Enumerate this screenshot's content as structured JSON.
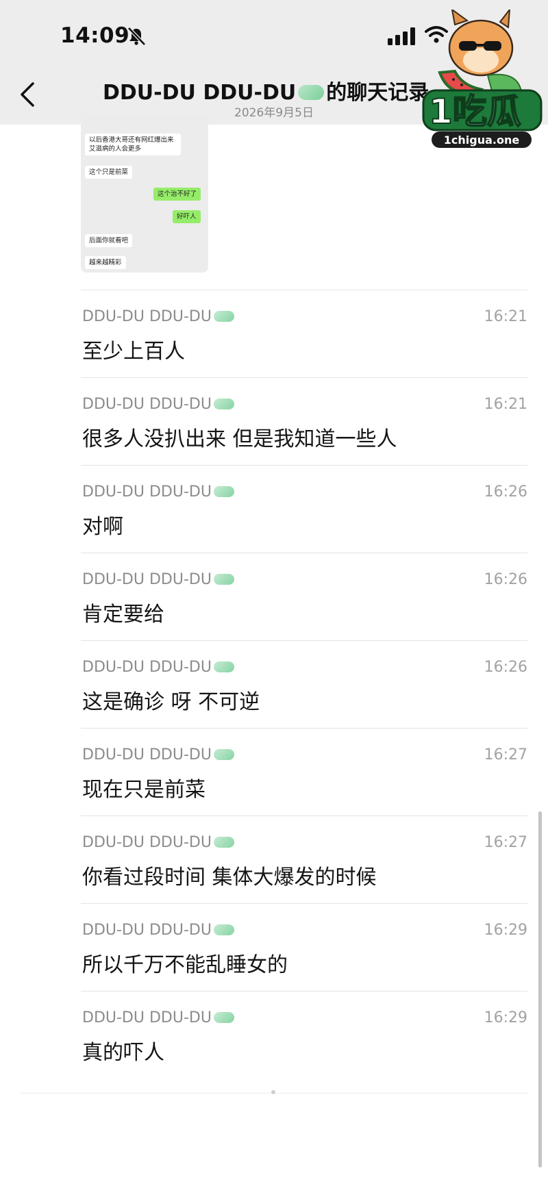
{
  "status_bar": {
    "time": "14:09",
    "icons": [
      "bell-off-icon",
      "signal-icon",
      "wifi-icon"
    ]
  },
  "nav": {
    "back_icon": "chevron-left-icon",
    "title_prefix": "DDU-DU DDU-DU",
    "title_suffix": "的聊天记录",
    "subtitle": "2026年9月5日"
  },
  "shared_image": {
    "messages": [
      {
        "side": "left",
        "text": "以后香港大哥还有网红爆出来艾滋病的人会更多"
      },
      {
        "side": "left",
        "text": "这个只是前菜"
      },
      {
        "side": "right",
        "text": "这个治不好了"
      },
      {
        "side": "right",
        "text": "好吓人"
      },
      {
        "side": "left",
        "text": "后面你就看吧"
      },
      {
        "side": "left",
        "text": "越来越精彩"
      }
    ]
  },
  "messages": [
    {
      "sender": "DDU-DU DDU-DU",
      "time": "16:21",
      "text": "至少上百人"
    },
    {
      "sender": "DDU-DU DDU-DU",
      "time": "16:21",
      "text": "很多人没扒出来 但是我知道一些人"
    },
    {
      "sender": "DDU-DU DDU-DU",
      "time": "16:26",
      "text": "对啊"
    },
    {
      "sender": "DDU-DU DDU-DU",
      "time": "16:26",
      "text": "肯定要给"
    },
    {
      "sender": "DDU-DU DDU-DU",
      "time": "16:26",
      "text": "这是确诊 呀 不可逆"
    },
    {
      "sender": "DDU-DU DDU-DU",
      "time": "16:27",
      "text": "现在只是前菜"
    },
    {
      "sender": "DDU-DU DDU-DU",
      "time": "16:27",
      "text": "你看过段时间 集体大爆发的时候"
    },
    {
      "sender": "DDU-DU DDU-DU",
      "time": "16:29",
      "text": "所以千万不能乱睡女的"
    },
    {
      "sender": "DDU-DU DDU-DU",
      "time": "16:29",
      "text": "真的吓人"
    }
  ],
  "watermark": {
    "brand": "1吃瓜",
    "domain": "1chigua.one"
  },
  "colors": {
    "header_bg": "#ededed",
    "bubble_right": "#95ec69",
    "bubble_left": "#ffffff",
    "meta_gray": "#8c8c8c"
  }
}
